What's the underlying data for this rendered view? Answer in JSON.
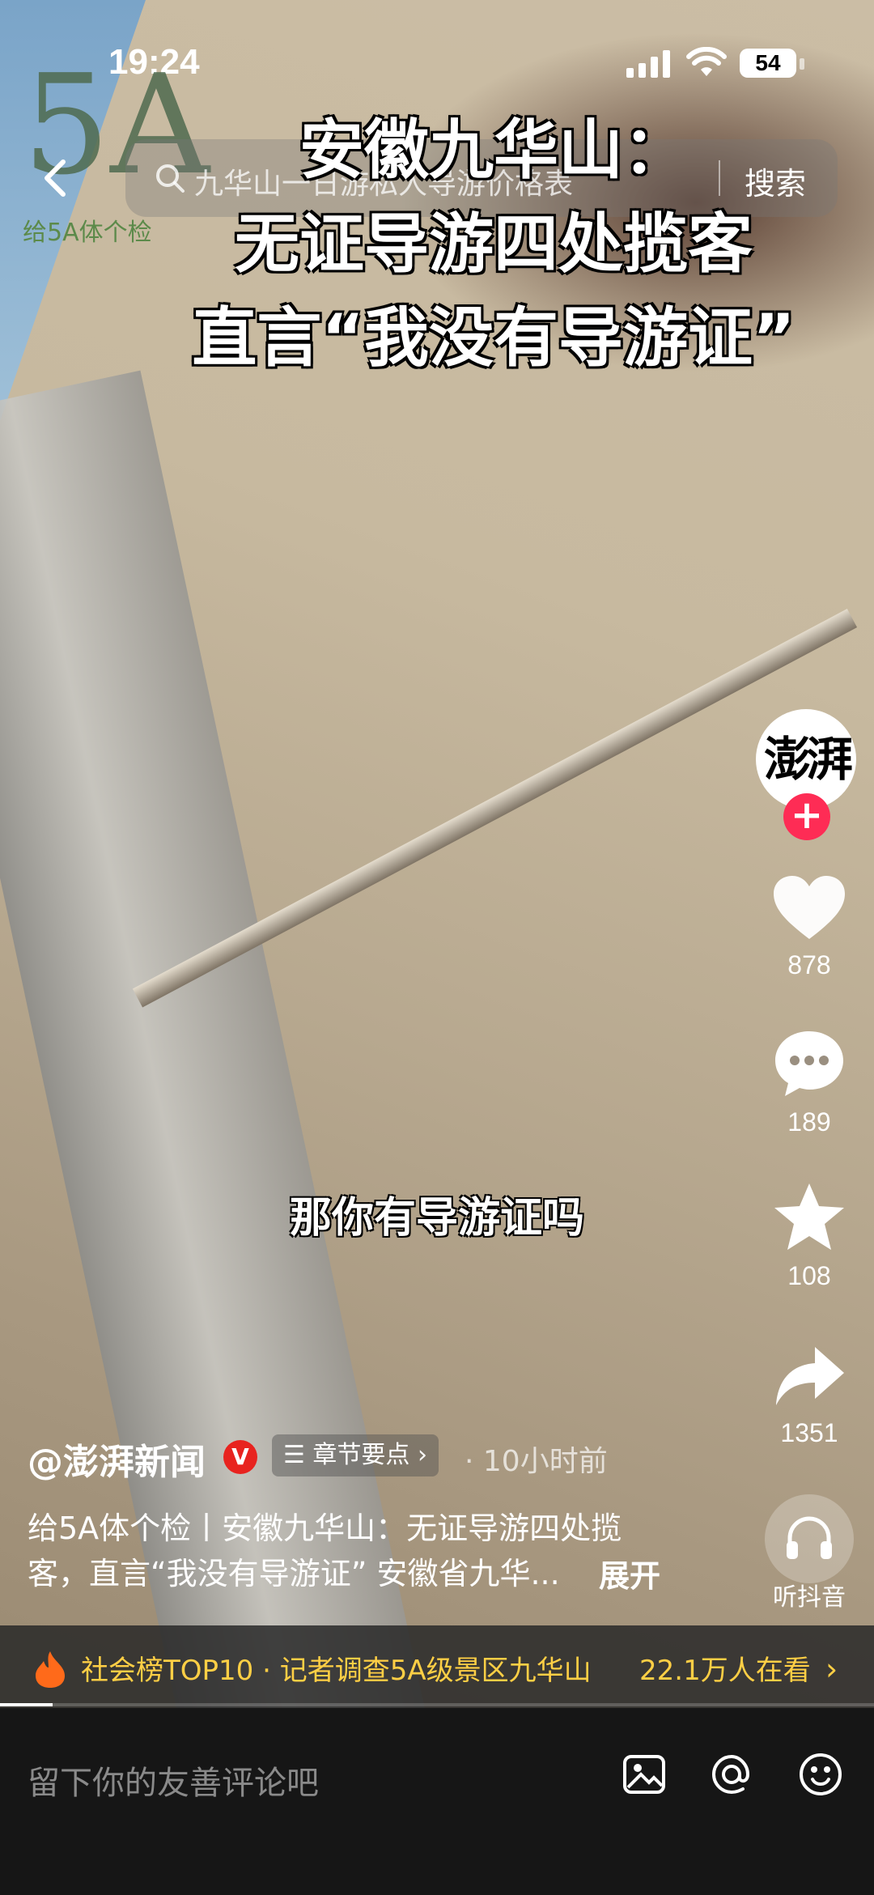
{
  "status": {
    "time": "19:24",
    "battery": "54"
  },
  "logo": {
    "glyph": "5A",
    "tag": "给5A体个检"
  },
  "search": {
    "query": "九华山一日游私人导游价格表",
    "button": "搜索"
  },
  "video": {
    "headline": [
      "安徽九华山：",
      "无证导游四处揽客",
      "直言“我没有导游证”"
    ],
    "subtitle": "那你有导游证吗"
  },
  "rail": {
    "avatar_text": "澎湃",
    "like_count": "878",
    "comment_count": "189",
    "favorite_count": "108",
    "share_count": "1351",
    "listen_label": "听抖音"
  },
  "post": {
    "author": "@澎湃新闻",
    "verified": "V",
    "chapter": "☰ 章节要点 ›",
    "time": "· 10小时前",
    "description": "给5A体个检丨安徽九华山：无证导游四处揽客，直言“我没有导游证” 安徽省九华...",
    "expand": "展开"
  },
  "hot": {
    "text": "社会榜TOP10 · 记者调查5A级景区九华山",
    "viewers": "22.1万人在看",
    "chevron": "›"
  },
  "progress": 0.06,
  "comment": {
    "placeholder": "留下你的友善评论吧"
  },
  "colors": {
    "accent": "#fe2c55",
    "hot": "#ffcf45",
    "verified": "#e8231f"
  },
  "icons": [
    "back-icon",
    "search-icon",
    "heart-icon",
    "comment-icon",
    "star-icon",
    "share-icon",
    "headphones-icon",
    "fire-icon",
    "image-icon",
    "at-icon",
    "emoji-icon"
  ]
}
